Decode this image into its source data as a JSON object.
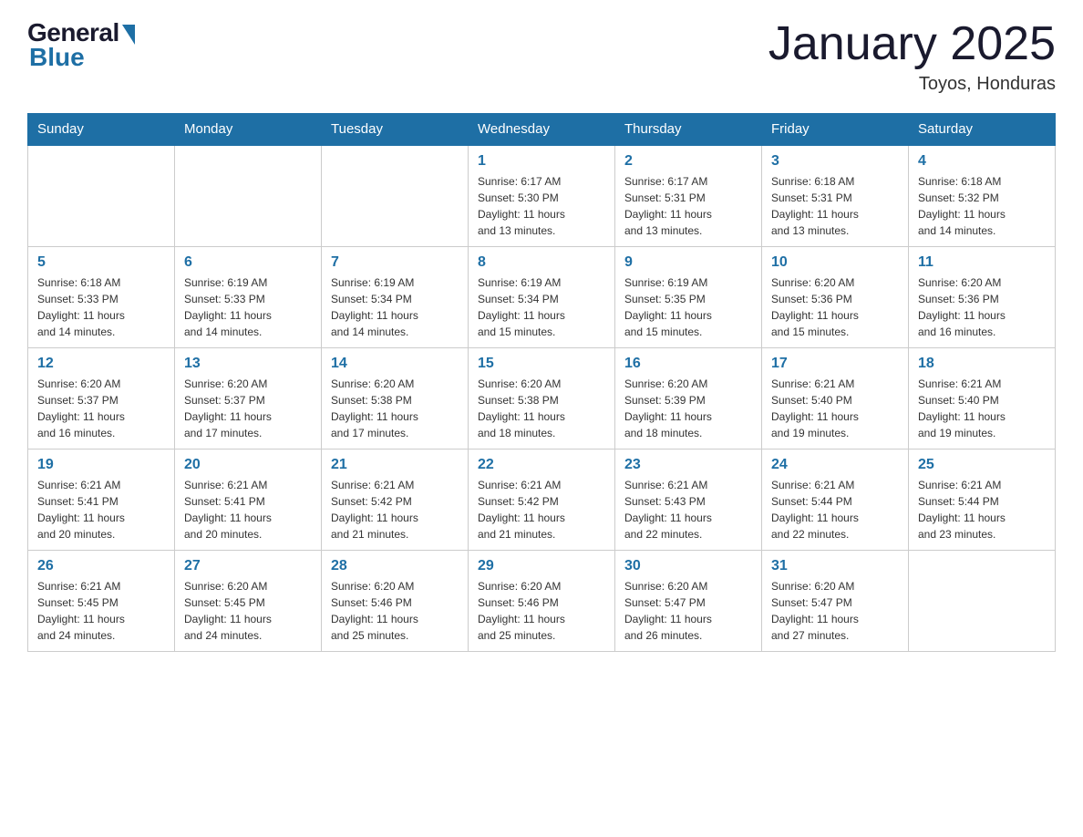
{
  "logo": {
    "general": "General",
    "blue": "Blue"
  },
  "title": "January 2025",
  "subtitle": "Toyos, Honduras",
  "days_of_week": [
    "Sunday",
    "Monday",
    "Tuesday",
    "Wednesday",
    "Thursday",
    "Friday",
    "Saturday"
  ],
  "weeks": [
    [
      {
        "day": "",
        "info": ""
      },
      {
        "day": "",
        "info": ""
      },
      {
        "day": "",
        "info": ""
      },
      {
        "day": "1",
        "info": "Sunrise: 6:17 AM\nSunset: 5:30 PM\nDaylight: 11 hours\nand 13 minutes."
      },
      {
        "day": "2",
        "info": "Sunrise: 6:17 AM\nSunset: 5:31 PM\nDaylight: 11 hours\nand 13 minutes."
      },
      {
        "day": "3",
        "info": "Sunrise: 6:18 AM\nSunset: 5:31 PM\nDaylight: 11 hours\nand 13 minutes."
      },
      {
        "day": "4",
        "info": "Sunrise: 6:18 AM\nSunset: 5:32 PM\nDaylight: 11 hours\nand 14 minutes."
      }
    ],
    [
      {
        "day": "5",
        "info": "Sunrise: 6:18 AM\nSunset: 5:33 PM\nDaylight: 11 hours\nand 14 minutes."
      },
      {
        "day": "6",
        "info": "Sunrise: 6:19 AM\nSunset: 5:33 PM\nDaylight: 11 hours\nand 14 minutes."
      },
      {
        "day": "7",
        "info": "Sunrise: 6:19 AM\nSunset: 5:34 PM\nDaylight: 11 hours\nand 14 minutes."
      },
      {
        "day": "8",
        "info": "Sunrise: 6:19 AM\nSunset: 5:34 PM\nDaylight: 11 hours\nand 15 minutes."
      },
      {
        "day": "9",
        "info": "Sunrise: 6:19 AM\nSunset: 5:35 PM\nDaylight: 11 hours\nand 15 minutes."
      },
      {
        "day": "10",
        "info": "Sunrise: 6:20 AM\nSunset: 5:36 PM\nDaylight: 11 hours\nand 15 minutes."
      },
      {
        "day": "11",
        "info": "Sunrise: 6:20 AM\nSunset: 5:36 PM\nDaylight: 11 hours\nand 16 minutes."
      }
    ],
    [
      {
        "day": "12",
        "info": "Sunrise: 6:20 AM\nSunset: 5:37 PM\nDaylight: 11 hours\nand 16 minutes."
      },
      {
        "day": "13",
        "info": "Sunrise: 6:20 AM\nSunset: 5:37 PM\nDaylight: 11 hours\nand 17 minutes."
      },
      {
        "day": "14",
        "info": "Sunrise: 6:20 AM\nSunset: 5:38 PM\nDaylight: 11 hours\nand 17 minutes."
      },
      {
        "day": "15",
        "info": "Sunrise: 6:20 AM\nSunset: 5:38 PM\nDaylight: 11 hours\nand 18 minutes."
      },
      {
        "day": "16",
        "info": "Sunrise: 6:20 AM\nSunset: 5:39 PM\nDaylight: 11 hours\nand 18 minutes."
      },
      {
        "day": "17",
        "info": "Sunrise: 6:21 AM\nSunset: 5:40 PM\nDaylight: 11 hours\nand 19 minutes."
      },
      {
        "day": "18",
        "info": "Sunrise: 6:21 AM\nSunset: 5:40 PM\nDaylight: 11 hours\nand 19 minutes."
      }
    ],
    [
      {
        "day": "19",
        "info": "Sunrise: 6:21 AM\nSunset: 5:41 PM\nDaylight: 11 hours\nand 20 minutes."
      },
      {
        "day": "20",
        "info": "Sunrise: 6:21 AM\nSunset: 5:41 PM\nDaylight: 11 hours\nand 20 minutes."
      },
      {
        "day": "21",
        "info": "Sunrise: 6:21 AM\nSunset: 5:42 PM\nDaylight: 11 hours\nand 21 minutes."
      },
      {
        "day": "22",
        "info": "Sunrise: 6:21 AM\nSunset: 5:42 PM\nDaylight: 11 hours\nand 21 minutes."
      },
      {
        "day": "23",
        "info": "Sunrise: 6:21 AM\nSunset: 5:43 PM\nDaylight: 11 hours\nand 22 minutes."
      },
      {
        "day": "24",
        "info": "Sunrise: 6:21 AM\nSunset: 5:44 PM\nDaylight: 11 hours\nand 22 minutes."
      },
      {
        "day": "25",
        "info": "Sunrise: 6:21 AM\nSunset: 5:44 PM\nDaylight: 11 hours\nand 23 minutes."
      }
    ],
    [
      {
        "day": "26",
        "info": "Sunrise: 6:21 AM\nSunset: 5:45 PM\nDaylight: 11 hours\nand 24 minutes."
      },
      {
        "day": "27",
        "info": "Sunrise: 6:20 AM\nSunset: 5:45 PM\nDaylight: 11 hours\nand 24 minutes."
      },
      {
        "day": "28",
        "info": "Sunrise: 6:20 AM\nSunset: 5:46 PM\nDaylight: 11 hours\nand 25 minutes."
      },
      {
        "day": "29",
        "info": "Sunrise: 6:20 AM\nSunset: 5:46 PM\nDaylight: 11 hours\nand 25 minutes."
      },
      {
        "day": "30",
        "info": "Sunrise: 6:20 AM\nSunset: 5:47 PM\nDaylight: 11 hours\nand 26 minutes."
      },
      {
        "day": "31",
        "info": "Sunrise: 6:20 AM\nSunset: 5:47 PM\nDaylight: 11 hours\nand 27 minutes."
      },
      {
        "day": "",
        "info": ""
      }
    ]
  ]
}
